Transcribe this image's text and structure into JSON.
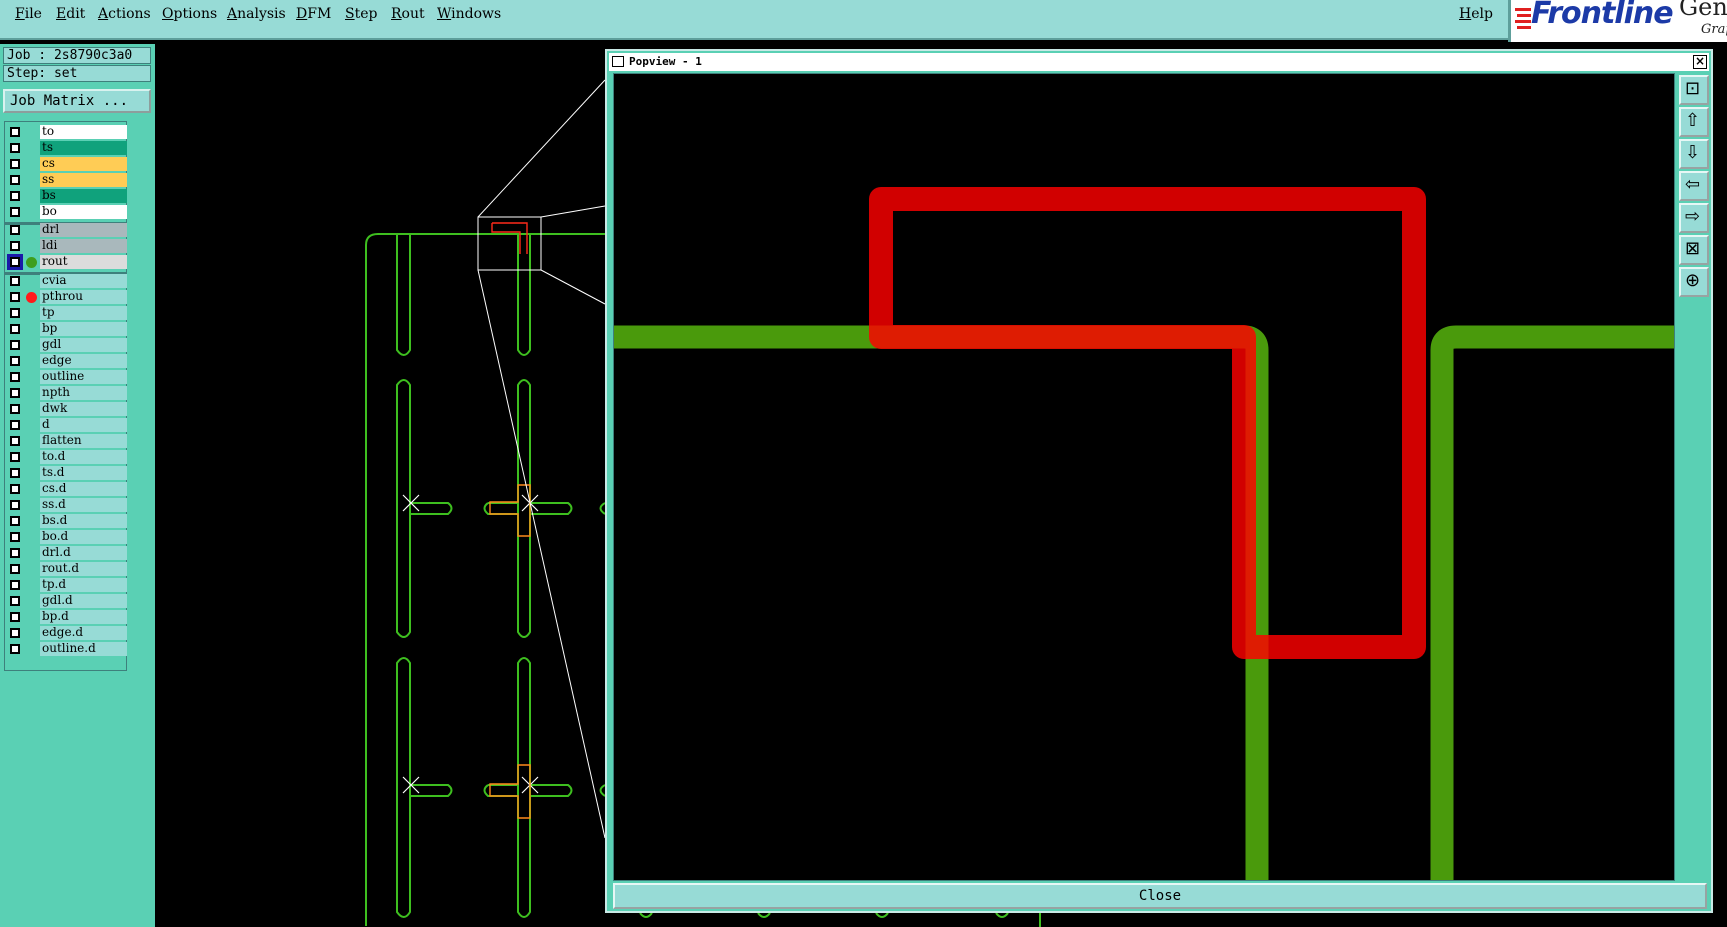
{
  "menu": {
    "items": [
      "File",
      "Edit",
      "Actions",
      "Options",
      "Analysis",
      "DFM",
      "Step",
      "Rout",
      "Windows"
    ],
    "help": "Help"
  },
  "brand": {
    "logo": "Frontline",
    "line1": "Gene",
    "line2": "Grap"
  },
  "left_panel": {
    "job_label": "Job : 2s8790c3a0",
    "step_label": "Step: set",
    "job_matrix_button": "Job Matrix ...",
    "groups": [
      [
        {
          "name": "to",
          "color": "#ffffff"
        },
        {
          "name": "ts",
          "color": "#10a27c"
        },
        {
          "name": "cs",
          "color": "#ffcc55"
        },
        {
          "name": "ss",
          "color": "#ffcc55"
        },
        {
          "name": "bs",
          "color": "#10a27c"
        },
        {
          "name": "bo",
          "color": "#ffffff"
        }
      ],
      [
        {
          "name": "drl",
          "color": "#a9b8bc"
        },
        {
          "name": "ldi",
          "color": "#a9b8bc"
        },
        {
          "name": "rout",
          "color": "#dcdcdc",
          "active": true,
          "dot": "#3e9e1d"
        }
      ],
      [
        {
          "name": "cvia",
          "color": "#97dbd6"
        },
        {
          "name": "pthrou",
          "color": "#97dbd6",
          "dot": "#ff1a1a"
        },
        {
          "name": "tp",
          "color": "#97dbd6"
        },
        {
          "name": "bp",
          "color": "#97dbd6"
        },
        {
          "name": "gdl",
          "color": "#97dbd6"
        },
        {
          "name": "edge",
          "color": "#97dbd6"
        },
        {
          "name": "outline",
          "color": "#97dbd6"
        },
        {
          "name": "npth",
          "color": "#97dbd6"
        },
        {
          "name": "dwk",
          "color": "#97dbd6"
        },
        {
          "name": "d",
          "color": "#97dbd6"
        },
        {
          "name": "flatten",
          "color": "#97dbd6"
        },
        {
          "name": "to.d",
          "color": "#97dbd6"
        },
        {
          "name": "ts.d",
          "color": "#97dbd6"
        },
        {
          "name": "cs.d",
          "color": "#97dbd6"
        },
        {
          "name": "ss.d",
          "color": "#97dbd6"
        },
        {
          "name": "bs.d",
          "color": "#97dbd6"
        },
        {
          "name": "bo.d",
          "color": "#97dbd6"
        },
        {
          "name": "drl.d",
          "color": "#97dbd6"
        },
        {
          "name": "rout.d",
          "color": "#97dbd6"
        },
        {
          "name": "tp.d",
          "color": "#97dbd6"
        },
        {
          "name": "gdl.d",
          "color": "#97dbd6"
        },
        {
          "name": "bp.d",
          "color": "#97dbd6"
        },
        {
          "name": "edge.d",
          "color": "#97dbd6"
        },
        {
          "name": "outline.d",
          "color": "#97dbd6"
        }
      ]
    ]
  },
  "popview": {
    "title": "Popview - 1",
    "close_label": "Close",
    "toolbar_icons": [
      "zoom-home-icon",
      "pan-up-icon",
      "pan-down-icon",
      "pan-left-icon",
      "pan-right-icon",
      "zoom-fit-icon",
      "zoom-center-icon"
    ]
  },
  "colors": {
    "menubar": "#97dbd6",
    "panel": "#5ad0b4",
    "outline_green": "#3ebf1f",
    "trace_green": "#4a9a0c",
    "highlight_red": "#ff0000"
  }
}
